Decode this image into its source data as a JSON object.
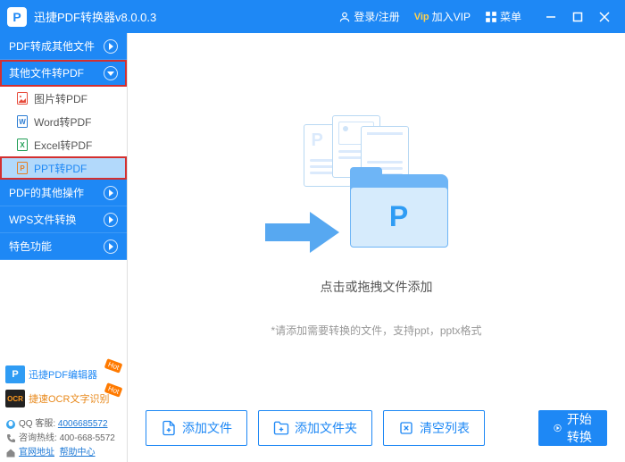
{
  "app": {
    "title": "迅捷PDF转换器v8.0.0.3",
    "login": "登录/注册",
    "vip": "加入VIP",
    "vip_prefix": "Vip",
    "menu": "菜单"
  },
  "sidebar": {
    "sections": [
      {
        "label": "PDF转成其他文件",
        "expanded": false
      },
      {
        "label": "其他文件转PDF",
        "expanded": true,
        "highlighted": true,
        "items": [
          {
            "label": "图片转PDF",
            "icon": "image",
            "color": "#e74c3c"
          },
          {
            "label": "Word转PDF",
            "icon": "word",
            "color": "#2b7cd3"
          },
          {
            "label": "Excel转PDF",
            "icon": "excel",
            "color": "#1f9d55"
          },
          {
            "label": "PPT转PDF",
            "icon": "ppt",
            "color": "#e67e22",
            "selected": true
          }
        ]
      },
      {
        "label": "PDF的其他操作",
        "expanded": false
      },
      {
        "label": "WPS文件转换",
        "expanded": false
      },
      {
        "label": "特色功能",
        "expanded": false
      }
    ]
  },
  "promo": [
    {
      "label": "迅捷PDF编辑器",
      "badge": "Hot",
      "icon_bg": "#2f9cf4",
      "icon_text": "P",
      "text_color": "#1e88f5"
    },
    {
      "label": "捷速OCR文字识别",
      "badge": "Hot",
      "icon_bg": "#222",
      "icon_text": "OCR",
      "text_color": "#e8881a"
    }
  ],
  "footer": {
    "qq_label": "QQ 客服:",
    "qq_value": "4006685572",
    "hotline_label": "咨询热线:",
    "hotline_value": "400-668-5572",
    "site_label": "官网地址",
    "help_label": "帮助中心"
  },
  "main": {
    "drop_text": "点击或拖拽文件添加",
    "hint_text": "*请添加需要转换的文件，支持ppt，pptx格式"
  },
  "actions": {
    "add_file": "添加文件",
    "add_folder": "添加文件夹",
    "clear_list": "清空列表",
    "start": "开始转换"
  }
}
